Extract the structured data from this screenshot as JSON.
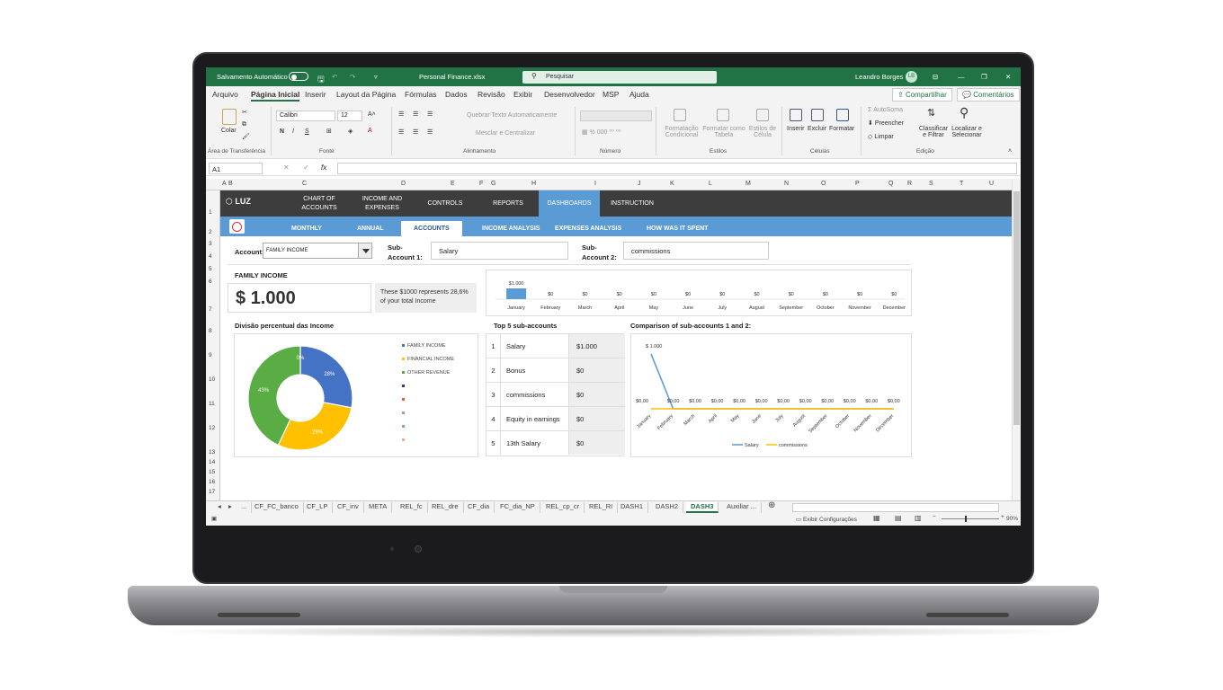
{
  "titlebar": {
    "autosave": "Salvamento Automático",
    "filename": "Personal Finance.xlsx",
    "search": "Pesquisar",
    "user": "Leandro Borges",
    "initials": "LB"
  },
  "menu": [
    "Arquivo",
    "Página Inicial",
    "Inserir",
    "Layout da Página",
    "Fórmulas",
    "Dados",
    "Revisão",
    "Exibir",
    "Desenvolvedor",
    "MSP",
    "Ajuda"
  ],
  "share": {
    "share": "Compartilhar",
    "comments": "Comentários"
  },
  "ribbon": {
    "paste": "Colar",
    "clipboard": "Área de Transferência",
    "font_name": "Calibri",
    "font_size": "12",
    "font_group": "Fonte",
    "wrap": "Quebrar Texto Automaticamente",
    "merge": "Mesclar e Centralizar",
    "align_group": "Alinhamento",
    "number_group": "Número",
    "cond_format": "Formatação Condicional",
    "format_table": "Formatar como Tabela",
    "cell_styles": "Estilos de Célula",
    "styles_group": "Estilos",
    "insert": "Inserir",
    "delete": "Excluir",
    "format": "Formatar",
    "cells_group": "Células",
    "autosum": "AutoSoma",
    "fill": "Preencher",
    "clear": "Limpar",
    "sort": "Classificar e Filtrar",
    "find": "Localizar e Selecionar",
    "edit_group": "Edição"
  },
  "namebox": "A1",
  "columns": [
    "A",
    "B",
    "C",
    "D",
    "E",
    "F",
    "G",
    "H",
    "I",
    "J",
    "K",
    "L",
    "M",
    "N",
    "O",
    "P",
    "Q",
    "R",
    "S",
    "T",
    "U"
  ],
  "rows": [
    "1",
    "2",
    "3",
    "4",
    "5",
    "6",
    "7",
    "8",
    "9",
    "10",
    "11",
    "12",
    "13",
    "14",
    "15",
    "16",
    "17"
  ],
  "dashboard": {
    "logo": "LUZ",
    "topnav": [
      "CHART OF ACCOUNTS",
      "INCOME AND EXPENSES",
      "CONTROLS",
      "REPORTS",
      "DASHBOARDS",
      "INSTRUCTION"
    ],
    "subnav": [
      "MONTHLY",
      "ANNUAL",
      "ACCOUNTS",
      "INCOME ANALYSIS",
      "EXPENSES ANALYSIS",
      "HOW WAS IT SPENT"
    ],
    "account_label": "Account:",
    "account_value": "FAMILY INCOME",
    "sub1_label": "Sub-Account 1:",
    "sub1_value": "Salary",
    "sub2_label": "Sub-Account 2:",
    "sub2_value": "commissions",
    "section_title": "FAMILY INCOME",
    "big_value": "$ 1.000",
    "big_note": "These $1000 represents 28,6% of your total Income",
    "pie_title": "Divisão percentual das Income",
    "top5_title": "Top 5 sub-accounts",
    "compare_title": "Comparison of sub-accounts 1 and 2:"
  },
  "top5": [
    {
      "n": "1",
      "name": "Salary",
      "value": "$1.000"
    },
    {
      "n": "2",
      "name": "Bonus",
      "value": "$0"
    },
    {
      "n": "3",
      "name": "commissions",
      "value": "$0"
    },
    {
      "n": "4",
      "name": "Equity in earnings",
      "value": "$0"
    },
    {
      "n": "5",
      "name": "13th Salary",
      "value": "$0"
    }
  ],
  "chart_data": [
    {
      "type": "bar",
      "categories": [
        "January",
        "February",
        "March",
        "April",
        "May",
        "June",
        "July",
        "August",
        "September",
        "October",
        "November",
        "December"
      ],
      "values": [
        1000,
        0,
        0,
        0,
        0,
        0,
        0,
        0,
        0,
        0,
        0,
        0
      ],
      "data_labels": [
        "$1.000",
        "$0",
        "$0",
        "$0",
        "$0",
        "$0",
        "$0",
        "$0",
        "$0",
        "$0",
        "$0",
        "$0"
      ],
      "color": "#5b9bd5"
    },
    {
      "type": "pie",
      "donut": true,
      "categories": [
        "FAMILY INCOME",
        "FINANCIAL INCOME",
        "OTHER REVENUE"
      ],
      "values": [
        28,
        29,
        43
      ],
      "extra_zero_label": "0%",
      "colors": [
        "#4472c4",
        "#ffc000",
        "#5aac44"
      ],
      "legend_markers": [
        "#2f3f7f",
        "#e06030",
        "#a0a0a0",
        "#70c070",
        "#f0b080"
      ],
      "legend": "right"
    },
    {
      "type": "line",
      "categories": [
        "January",
        "February",
        "March",
        "April",
        "May",
        "June",
        "July",
        "August",
        "September",
        "October",
        "November",
        "December"
      ],
      "series": [
        {
          "name": "Salary",
          "values": [
            1000,
            0,
            0,
            0,
            0,
            0,
            0,
            0,
            0,
            0,
            0,
            0
          ],
          "color": "#5b9bd5"
        },
        {
          "name": "commissions",
          "values": [
            0,
            0,
            0,
            0,
            0,
            0,
            0,
            0,
            0,
            0,
            0,
            0
          ],
          "color": "#ffc000"
        }
      ],
      "data_labels": [
        "$ 1.000",
        "$0,00",
        "$0,00",
        "$0,00",
        "$0,00",
        "$0,00",
        "$0,00",
        "$0,00",
        "$0,00",
        "$0,00",
        "$0,00",
        "$0,00",
        "$0,00"
      ],
      "legend": "bottom"
    }
  ],
  "sheets": [
    "...",
    "CF_FC_banco",
    "CF_LP",
    "CF_inv",
    "META",
    "REL_fc",
    "REL_dre",
    "CF_dia",
    "FC_dia_NP",
    "REL_cp_cr",
    "REL_RI",
    "DASH1",
    "DASH2",
    "DASH3",
    "Auxiliar ..."
  ],
  "active_sheet": "DASH3",
  "status": {
    "display": "Exibir Configurações",
    "zoom": "90%"
  }
}
